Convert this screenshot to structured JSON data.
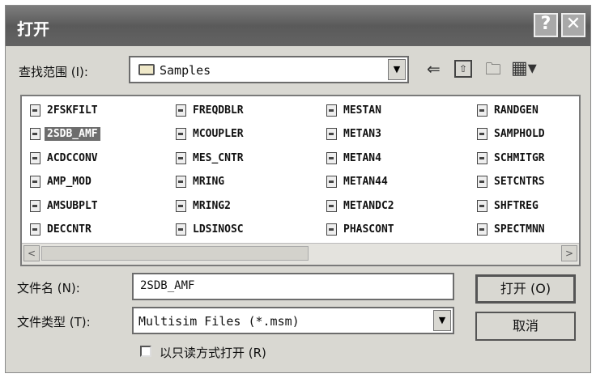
{
  "window": {
    "title": "打开"
  },
  "titlebar": {
    "help_glyph": "?",
    "close_glyph": "✕"
  },
  "lookin": {
    "label": "查找范围 (I):",
    "value": "Samples",
    "drop_glyph": "▼"
  },
  "toolbar": {
    "back_glyph": "⇐",
    "up_glyph": "⇧",
    "new_folder_glyph": "🗀",
    "view_glyph": "▦▾"
  },
  "files": [
    [
      "2FSKFILT",
      "2SDB_AMF",
      "ACDCCONV",
      "AMP_MOD",
      "AMSUBPLT",
      "DECCNTR"
    ],
    [
      "FREQDBLR",
      "MCOUPLER",
      "MES_CNTR",
      "MRING",
      "MRING2",
      "LDSINOSC"
    ],
    [
      "MESTAN",
      "METAN3",
      "METAN4",
      "METAN44",
      "METANDC2",
      "PHASCONT"
    ],
    [
      "RANDGEN",
      "SAMPHOLD",
      "SCHMITGR",
      "SETCNTRS",
      "SHFTREG",
      "SPECTMNN"
    ]
  ],
  "selected_file": "2SDB_AMF",
  "scroll": {
    "left_glyph": "<",
    "right_glyph": ">"
  },
  "filename": {
    "label": "文件名 (N):",
    "value": "2SDB_AMF"
  },
  "filetype": {
    "label": "文件类型 (T):",
    "value": "Multisim Files (*.msm)",
    "drop_glyph": "▼"
  },
  "buttons": {
    "open": "打开 (O)",
    "cancel": "取消"
  },
  "readonly": {
    "label": "以只读方式打开 (R)",
    "checked": false
  }
}
